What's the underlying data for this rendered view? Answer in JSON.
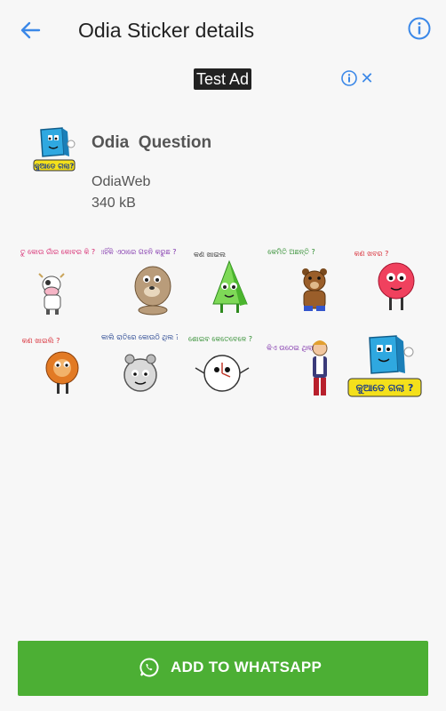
{
  "header": {
    "title": "Odia Sticker details",
    "back_icon": "arrow-left-icon",
    "info_icon": "info-circle-icon",
    "accent": "#3b88e8"
  },
  "ad": {
    "label": "Test Ad",
    "info_icon": "adchoices-info-icon",
    "close_icon": "close-icon"
  },
  "pack": {
    "name": "Odia  Question",
    "publisher": "OdiaWeb",
    "size": "340 kB",
    "tray_text": "କୁଆଡେ ଗଲା?"
  },
  "stickers": [
    {
      "caption": "ତୁ କୋଉ ଗାଁର କୋବର କି ?",
      "character": "cow"
    },
    {
      "caption": "କାହିଁକି ଏଠାରେ ଗହନି କରୁଛ ?",
      "character": "bulldog"
    },
    {
      "caption": "କଣ ଖାଇଲ",
      "character": "green-pyramid"
    },
    {
      "caption": "କେମିତି ଅଛନ୍ତି ?",
      "character": "bear"
    },
    {
      "caption": "କଣ ଖବର ?",
      "character": "pink-ball"
    },
    {
      "caption": "କଣ ଖାଇଲି ?",
      "character": "donut"
    },
    {
      "caption": "କାଲି ରାତିରେ କୋଉଠି ଥିଲ ?",
      "character": "alarm-clock"
    },
    {
      "caption": "ଶୋଇବ କେତେବେଳେ ?",
      "character": "clock"
    },
    {
      "caption": "ଏ ଫଟ କିଏ ଉଠେଇ ଥିଲା କି ?",
      "character": "man"
    },
    {
      "caption": "କୁଆଡେ ଗଲା ?",
      "character": "blue-box"
    }
  ],
  "cta": {
    "label": "ADD TO WHATSAPP",
    "icon": "whatsapp-icon",
    "color": "#4caf34"
  }
}
